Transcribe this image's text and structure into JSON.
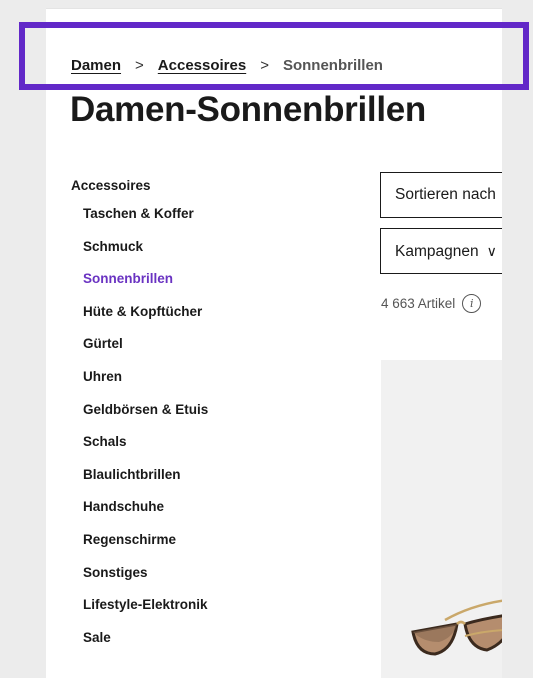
{
  "breadcrumb": {
    "items": [
      {
        "label": "Damen"
      },
      {
        "label": "Accessoires"
      }
    ],
    "current": "Sonnenbrillen",
    "separator": ">"
  },
  "page_title": "Damen-Sonnenbrillen",
  "sidebar": {
    "heading": "Accessoires",
    "items": [
      {
        "label": "Taschen & Koffer"
      },
      {
        "label": "Schmuck"
      },
      {
        "label": "Sonnenbrillen"
      },
      {
        "label": "Hüte & Kopftücher"
      },
      {
        "label": "Gürtel"
      },
      {
        "label": "Uhren"
      },
      {
        "label": "Geldbörsen & Etuis"
      },
      {
        "label": "Schals"
      },
      {
        "label": "Blaulichtbrillen"
      },
      {
        "label": "Handschuhe"
      },
      {
        "label": "Regenschirme"
      },
      {
        "label": "Sonstiges"
      },
      {
        "label": "Lifestyle-Elektronik"
      },
      {
        "label": "Sale"
      }
    ]
  },
  "controls": {
    "sort_label": "Sortieren nach",
    "campaign_label": "Kampagnen",
    "campaign_chevron": "chevron-down-icon"
  },
  "results": {
    "count_text": "4 663 Artikel",
    "info_icon": "info-icon"
  },
  "colors": {
    "active": "#6a33c2",
    "highlight": "#6228c8"
  }
}
